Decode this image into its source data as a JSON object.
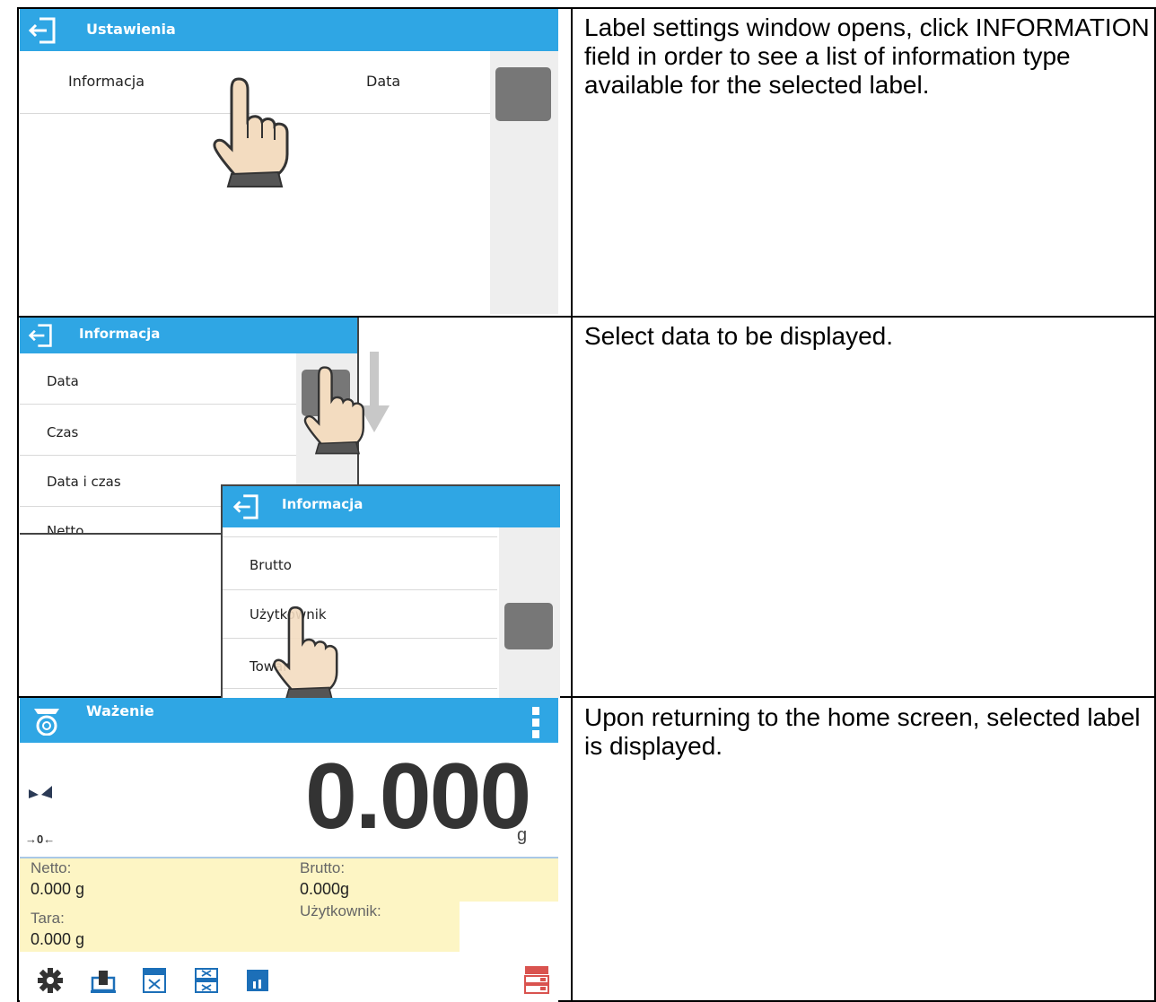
{
  "rows": [
    {
      "description": "Label settings window opens, click INFORMATION field in order to see a list of information type available for the selected label.",
      "screen": {
        "title": "Ustawienia",
        "item_label": "Informacja",
        "item_value": "Data"
      }
    },
    {
      "description": "Select data to be displayed.",
      "screen_a": {
        "title": "Informacja",
        "items": [
          "Data",
          "Czas",
          "Data i czas",
          "Netto"
        ]
      },
      "screen_b": {
        "title": "Informacja",
        "items": [
          "Brutto",
          "Użytkownik",
          "Towar"
        ]
      }
    },
    {
      "description": "Upon returning to the home screen, selected label is displayed.",
      "screen": {
        "title": "Ważenie",
        "reading": "0.000",
        "unit": "g",
        "zero_marker": "→0←",
        "fields": [
          {
            "label": "Netto:",
            "value": "0.000 g"
          },
          {
            "label": "Brutto:",
            "value": "0.000g"
          },
          {
            "label": "Tara:",
            "value": "0.000 g"
          },
          {
            "label": "Użytkownik:",
            "value": ""
          }
        ]
      }
    }
  ],
  "colors": {
    "titlebar": "#2fa6e4",
    "info_panel": "#fdf5c4",
    "scroll_thumb": "#777777"
  }
}
